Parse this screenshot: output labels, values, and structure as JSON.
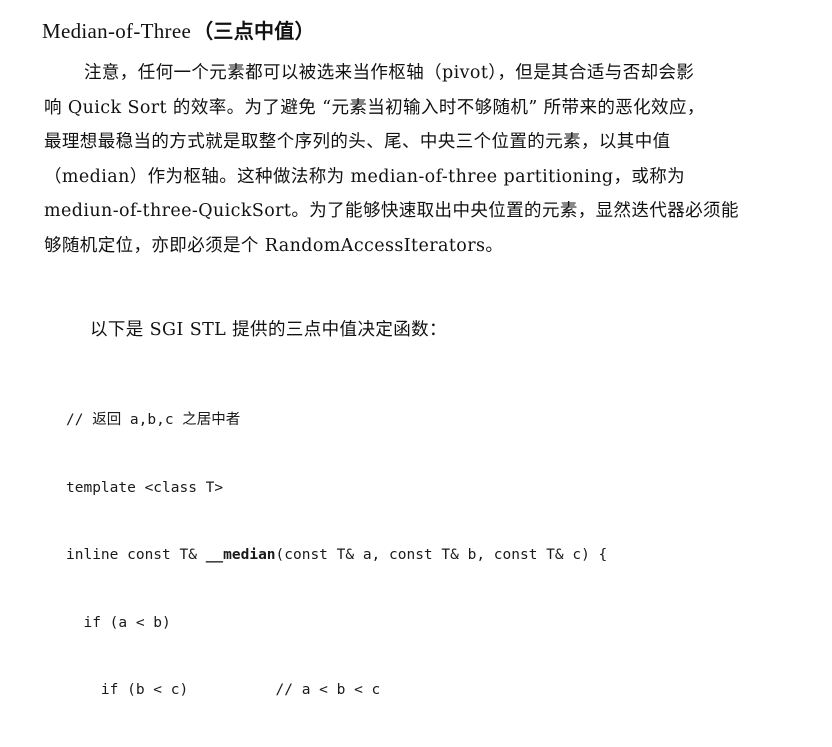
{
  "heading": {
    "latin": "Median-of-Three",
    "cjk": "（三点中值）"
  },
  "paragraph": {
    "lines": [
      "注意，任何一个元素都可以被选来当作枢轴（pivot），但是其合适与否却会影",
      "响 Quick Sort 的效率。为了避免 “元素当初输入时不够随机” 所带来的恶化效应，",
      "最理想最稳当的方式就是取整个序列的头、尾、中央三个位置的元素，以其中值",
      "（median）作为枢轴。这种做法称为 median-of-three partitioning，或称为",
      "mediun-of-three-QuickSort。为了能够快速取出中央位置的元素，显然迭代器必须能",
      "够随机定位，亦即必须是个 RandomAccessIterators。"
    ]
  },
  "intro": "以下是 SGI STL 提供的三点中值决定函数：",
  "code": {
    "line1": "// 返回 a,b,c 之居中者",
    "line2": "template <class T>",
    "line3_prefix": "inline const T& ",
    "line3_func": "__median",
    "line3_suffix": "(const T& a, const T& b, const T& c) {",
    "line4": "  if (a < b)",
    "line5": "    if (b < c)          // a < b < c"
  }
}
